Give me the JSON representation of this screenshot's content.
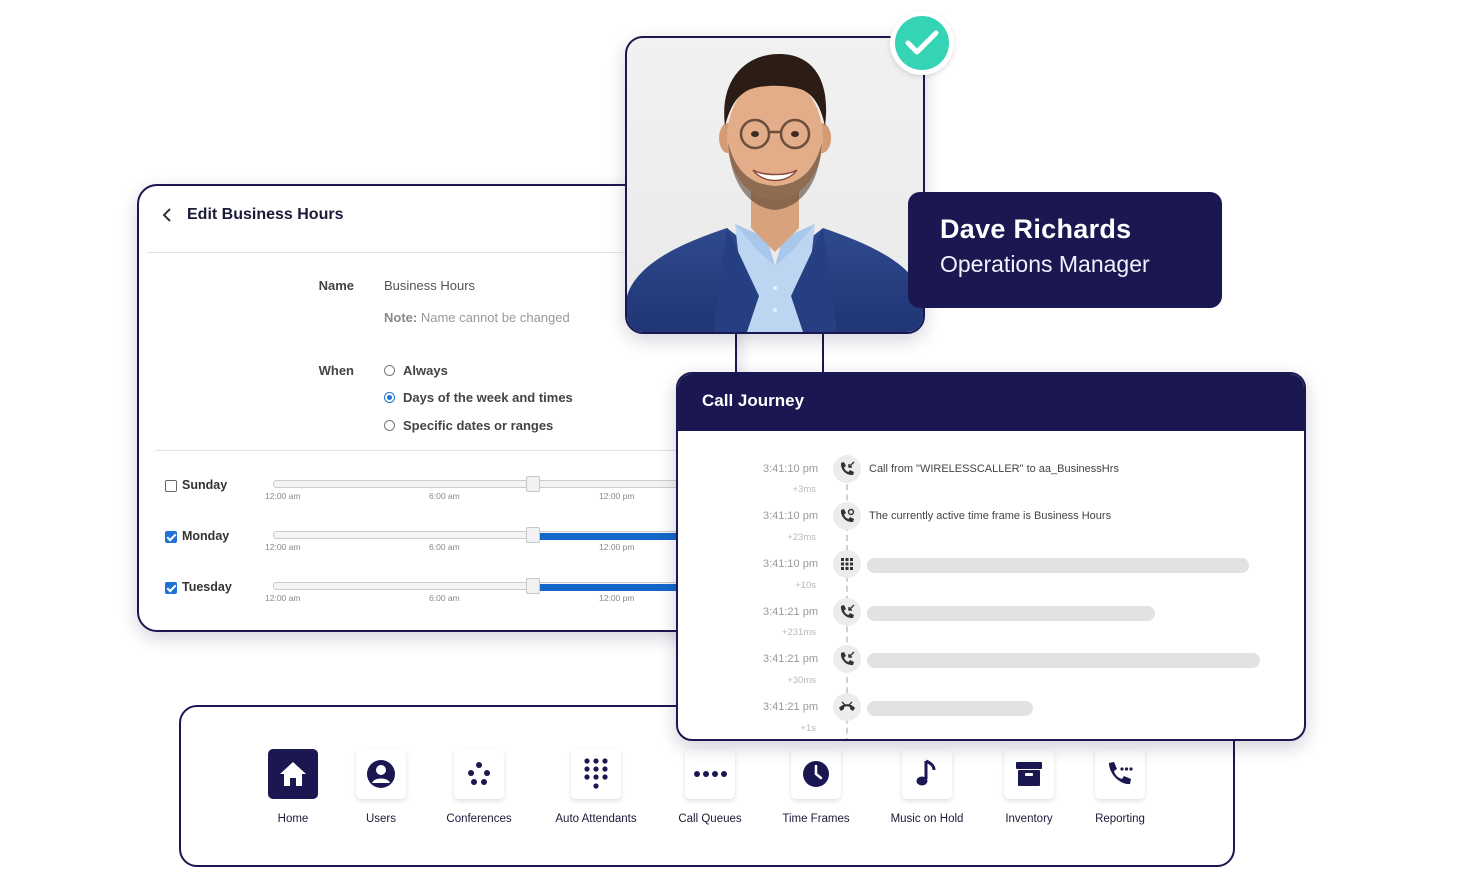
{
  "business_hours": {
    "title": "Edit Business Hours",
    "name_label": "Name",
    "name_value": "Business Hours",
    "note_prefix": "Note:",
    "note_text": " Name cannot be changed",
    "when_label": "When",
    "options": [
      {
        "label": "Always",
        "selected": false
      },
      {
        "label": "Days of the week and times",
        "selected": true
      },
      {
        "label": "Specific dates or ranges",
        "selected": false
      }
    ],
    "days": [
      {
        "name": "Sunday",
        "checked": false,
        "ticks": [
          "12:00 am",
          "6:00 am",
          "12:00 pm"
        ]
      },
      {
        "name": "Monday",
        "checked": true,
        "ticks": [
          "12:00 am",
          "6:00 am",
          "12:00 pm"
        ]
      },
      {
        "name": "Tuesday",
        "checked": true,
        "ticks": [
          "12:00 am",
          "6:00 am",
          "12:00 pm"
        ]
      }
    ]
  },
  "profile": {
    "name": "Dave Richards",
    "role": "Operations Manager"
  },
  "call_journey": {
    "title": "Call Journey",
    "events": [
      {
        "time": "3:41:10 pm",
        "delta": "+3ms",
        "icon": "incoming-call-icon",
        "text": "Call from \"WIRELESSCALLER\" to aa_BusinessHrs"
      },
      {
        "time": "3:41:10 pm",
        "delta": "+23ms",
        "icon": "call-settings-icon",
        "text": "The currently active time frame is Business Hours"
      },
      {
        "time": "3:41:10 pm",
        "delta": "+10s",
        "icon": "keypad-icon",
        "text": ""
      },
      {
        "time": "3:41:21 pm",
        "delta": "+231ms",
        "icon": "incoming-call-icon",
        "text": ""
      },
      {
        "time": "3:41:21 pm",
        "delta": "+30ms",
        "icon": "incoming-call-icon",
        "text": ""
      },
      {
        "time": "3:41:21 pm",
        "delta": "+1s",
        "icon": "hangup-icon",
        "text": ""
      }
    ]
  },
  "nav": {
    "items": [
      {
        "label": "Home",
        "icon": "home-icon",
        "active": true
      },
      {
        "label": "Users",
        "icon": "user-icon",
        "active": false
      },
      {
        "label": "Conferences",
        "icon": "conference-icon",
        "active": false
      },
      {
        "label": "Auto Attendants",
        "icon": "keypad-icon",
        "active": false
      },
      {
        "label": "Call Queues",
        "icon": "queue-icon",
        "active": false
      },
      {
        "label": "Time Frames",
        "icon": "clock-icon",
        "active": false
      },
      {
        "label": "Music on Hold",
        "icon": "music-icon",
        "active": false
      },
      {
        "label": "Inventory",
        "icon": "archive-icon",
        "active": false
      },
      {
        "label": "Reporting",
        "icon": "phone-report-icon",
        "active": false
      }
    ]
  },
  "colors": {
    "navy": "#1b1750",
    "accent_blue": "#1467c8",
    "check_teal": "#35d4b4"
  }
}
